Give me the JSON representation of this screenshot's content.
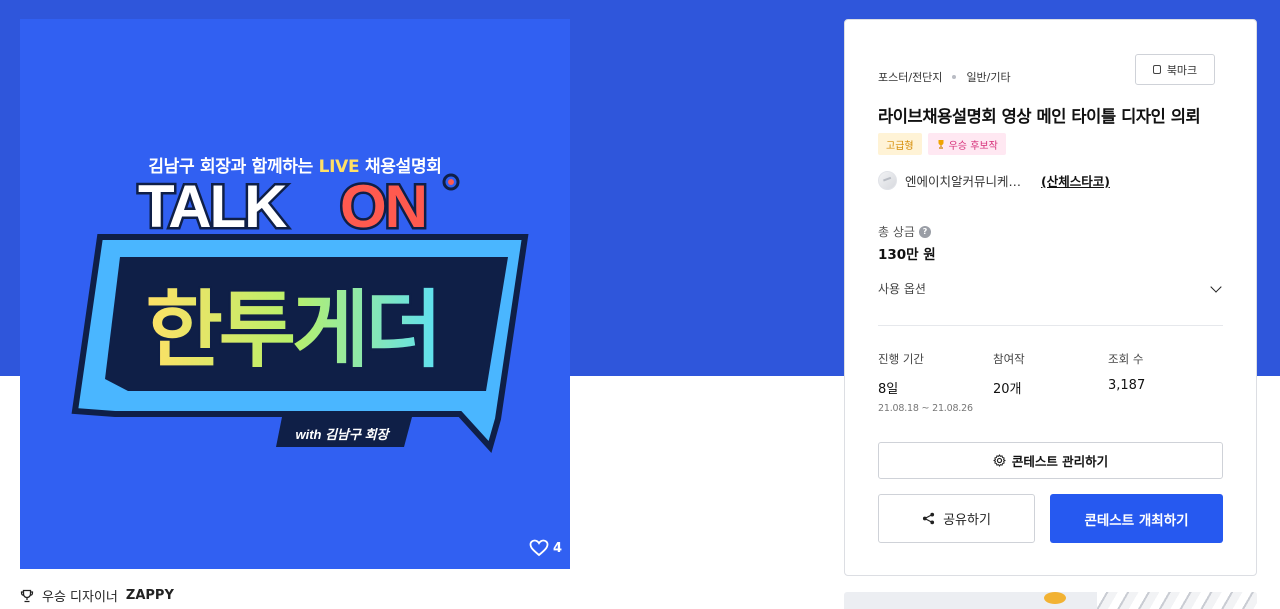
{
  "poster": {
    "subtitle_prefix": "김남구 회장과 함께하는 ",
    "subtitle_live": "LIVE",
    "subtitle_suffix": " 채용설명회",
    "logo_talk": "TALK",
    "logo_on": "ON",
    "logo_korean": "한투게더",
    "logo_with": "with 김남구 회장",
    "like_count": "4"
  },
  "winner_line": {
    "label": "우승 디자이너",
    "name": "ZAPPY"
  },
  "card": {
    "breadcrumb": [
      "포스터/전단지",
      "일반/기타"
    ],
    "bookmark_label": "북마크",
    "title": "라이브채용설명회 영상 메인 타이틀 디자인 의뢰",
    "tags": {
      "grade": "고급형",
      "winner": "우승 후보작"
    },
    "host_name": "엔에이치알커뮤니케…",
    "host_link": "(산체스타코)",
    "prize_label": "총 상금",
    "prize_value": "130만 원",
    "options_label": "사용 옵션",
    "stats": {
      "period_label": "진행 기간",
      "period_value": "8일",
      "period_range": "21.08.18 ~ 21.08.26",
      "entries_label": "참여작",
      "entries_value": "20개",
      "views_label": "조회 수",
      "views_value": "3,187"
    },
    "manage_label": "콘테스트 관리하기",
    "share_label": "공유하기",
    "host_contest_label": "콘테스트 개최하기"
  },
  "colors": {
    "hero_bg": "#2f56db",
    "poster_bg": "#3160f2",
    "primary_button": "#2659f0",
    "logo_on": "#ff5a4f",
    "logo_yellow": "#ffe066"
  }
}
